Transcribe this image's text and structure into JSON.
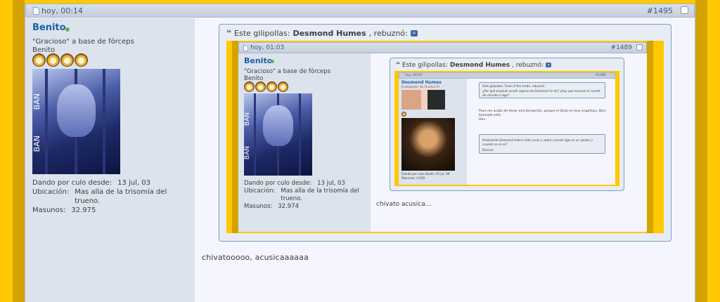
{
  "post": {
    "date": "hoy, 00:14",
    "number": "#1495",
    "user": {
      "name": "Benito",
      "title_line1": "\"Gracioso\" a base de fórceps",
      "title_line2": "Benito",
      "avatar_text_top": "BAN",
      "avatar_text_bottom": "BAN",
      "stats": [
        {
          "label": "Dando por culo desde:",
          "value": "13 jul, 03"
        },
        {
          "label": "Ubicación:",
          "value": "Mas alla de la trisomía del trueno."
        },
        {
          "label": "Masunos:",
          "value": "32.975"
        }
      ]
    },
    "quote": {
      "prefix": "Este gilipollas:",
      "author": "Desmond Humes",
      "suffix": ", rebuznó:",
      "inner_post": {
        "date": "hoy, 01:03",
        "number": "#1489",
        "user": {
          "name": "Benito",
          "title_line1": "\"Gracioso\" a base de fórceps",
          "title_line2": "Benito",
          "avatar_text_top": "BAN",
          "avatar_text_bottom": "BAN",
          "stats": [
            {
              "label": "Dando por culo desde:",
              "value": "13 jul, 03"
            },
            {
              "label": "Ubicación:",
              "value": "Mas alla de la trisomía del trueno."
            },
            {
              "label": "Masunos:",
              "value": "32.974"
            }
          ]
        },
        "quote": {
          "prefix": "Este gilipollas:",
          "author": "Desmond Humes",
          "suffix": ", rebuznó:",
          "thumb": {
            "date": "hoy, 00:43",
            "number": "#1486",
            "username": "Desmond Humes",
            "user_subtitle": "Embajador de Huelva Pi",
            "stats_line1": "Dando por culo desde:   25 jul, 09",
            "stats_line2": "Masunos:   4.020",
            "quote1_header": "Este gilipollas: Tools of the trade, rebuznó:",
            "quote1_text": "¿Por qué empezó acudir alguno de Desmond Vs lol? ¿Hay que sacarse el carnet de chivato o algo?",
            "body_line1": "Pues me acabo de llevar una decepción, porque el título es muy engañoso. Bien",
            "body_line2": "baneado está.",
            "body_line3": "Hdv.",
            "quote2_text": "Realmente Desmond habrá visto Louie y sabrá cuando algo es un spoiler y cuando no lo es?",
            "quote2_sig": "Discuss"
          }
        },
        "message": "chivato acusica..."
      }
    },
    "message": "chivatooooo, acusicaaaaaa"
  },
  "colors": {
    "background": "#ffc800",
    "side_stripe": "#d4a300",
    "post_bg": "#f5f5ff",
    "userinfo_bg": "#dce3ed",
    "username": "#1d5fa6"
  }
}
